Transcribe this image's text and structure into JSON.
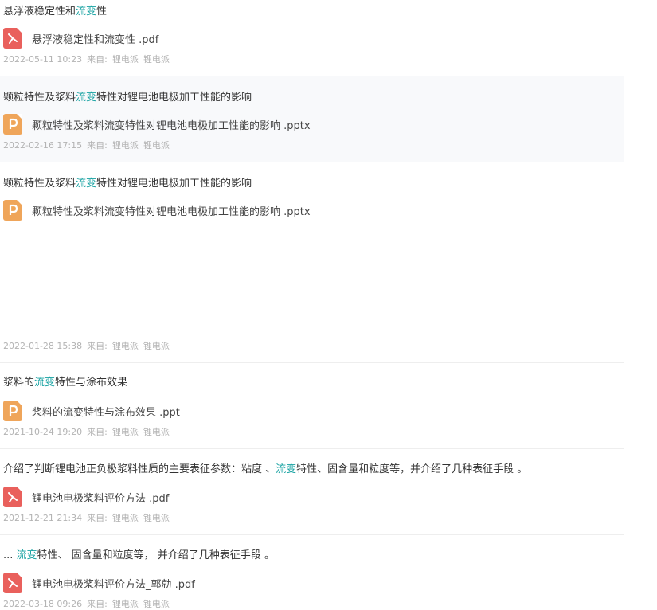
{
  "results": [
    {
      "title_pre": "悬浮液稳定性和",
      "title_kw": "流变",
      "title_post": "性",
      "file_type": "pdf",
      "file_name": "悬浮液稳定性和流变性 .pdf",
      "date": "2022-05-11 10:23",
      "source_label": "来自:",
      "source": "锂电派",
      "author": "锂电派"
    },
    {
      "title_pre": "颗粒特性及浆料",
      "title_kw": "流变",
      "title_post": "特性对锂电池电极加工性能的影响",
      "file_type": "ppt",
      "file_name": "颗粒特性及浆料流变特性对锂电池电极加工性能的影响 .pptx",
      "date": "2022-02-16 17:15",
      "source_label": "来自:",
      "source": "锂电派",
      "author": "锂电派"
    },
    {
      "title_pre": "颗粒特性及浆料",
      "title_kw": "流变",
      "title_post": "特性对锂电池电极加工性能的影响",
      "file_type": "ppt",
      "file_name": "颗粒特性及浆料流变特性对锂电池电极加工性能的影响 .pptx",
      "date": "2022-01-28 15:38",
      "source_label": "来自:",
      "source": "锂电派",
      "author": "锂电派"
    },
    {
      "title_pre": "浆料的",
      "title_kw": "流变",
      "title_post": "特性与涂布效果",
      "file_type": "ppt",
      "file_name": "浆料的流变特性与涂布效果 .ppt",
      "date": "2021-10-24 19:20",
      "source_label": "来自:",
      "source": "锂电派",
      "author": "锂电派"
    },
    {
      "title_pre": "介绍了判断锂电池正负极浆料性质的主要表征参数：粘度 、",
      "title_kw": "流变",
      "title_post": "特性、固含量和粒度等，并介绍了几种表征手段 。",
      "file_type": "pdf",
      "file_name": "锂电池电极浆料评价方法 .pdf",
      "date": "2021-12-21 21:34",
      "source_label": "来自:",
      "source": "锂电派",
      "author": "锂电派"
    },
    {
      "title_pre": "... ",
      "title_kw": "流变",
      "title_post": "特性、 固含量和粒度等， 并介绍了几种表征手段 。",
      "file_type": "pdf",
      "file_name": "锂电池电极浆料评价方法_郭勍 .pdf",
      "date": "2022-03-18 09:26",
      "source_label": "来自:",
      "source": "锂电派",
      "author": "锂电派"
    }
  ]
}
